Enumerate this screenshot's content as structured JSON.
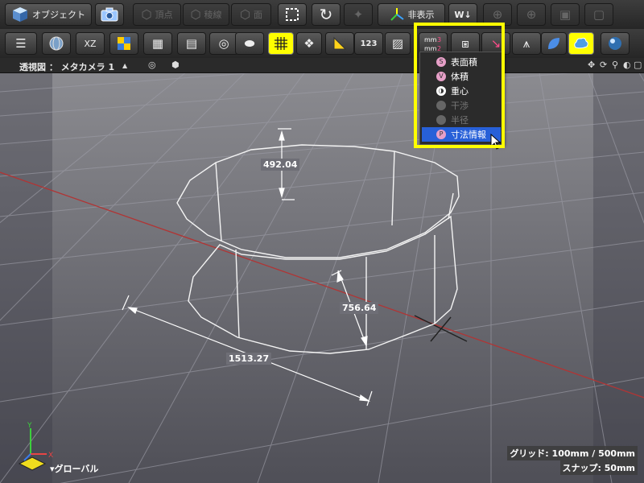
{
  "toolbar_top": {
    "object_label": "オブジェクト",
    "vertex_label": "頂点",
    "edge_label": "稜線",
    "face_label": "面",
    "hide_label": "非表示"
  },
  "toolbar_bottom": {
    "plane_label": "XZ",
    "numeric_label": "123"
  },
  "viewport": {
    "title": "透視図 ： メタカメラ 1",
    "grid_status": "グリッド: 100mm / 500mm",
    "snap_status": "スナップ: 50mm",
    "coord_label": "グローバル"
  },
  "measure_menu": {
    "items": [
      {
        "label": "表面積",
        "icon": "surface-area-icon",
        "enabled": true,
        "selected": false
      },
      {
        "label": "体積",
        "icon": "volume-icon",
        "enabled": true,
        "selected": false
      },
      {
        "label": "重心",
        "icon": "center-of-gravity-icon",
        "enabled": true,
        "selected": false
      },
      {
        "label": "干渉",
        "icon": "interference-icon",
        "enabled": false,
        "selected": false
      },
      {
        "label": "半径",
        "icon": "radius-icon",
        "enabled": false,
        "selected": false
      },
      {
        "label": "寸法情報",
        "icon": "dimension-info-icon",
        "enabled": true,
        "selected": true
      }
    ]
  },
  "dimensions": {
    "height": "492.04",
    "radius": "756.64",
    "diameter": "1513.27"
  },
  "colors": {
    "highlight": "#ffff00",
    "selection": "#2760d8",
    "x_axis": "#c03030"
  }
}
